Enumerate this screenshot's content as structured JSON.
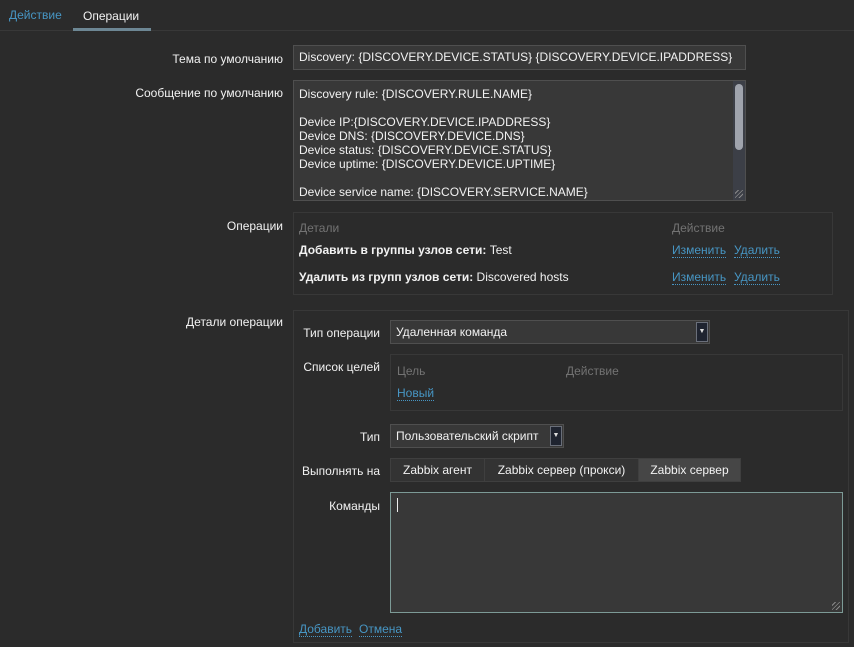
{
  "tabs": [
    {
      "label": "Действие",
      "active": false
    },
    {
      "label": "Операции",
      "active": true
    }
  ],
  "form": {
    "subject_label": "Тема по умолчанию",
    "subject_value": "Discovery: {DISCOVERY.DEVICE.STATUS} {DISCOVERY.DEVICE.IPADDRESS}",
    "message_label": "Сообщение по умолчанию",
    "message_lines": [
      "Discovery rule: {DISCOVERY.RULE.NAME}",
      "",
      "Device IP:{DISCOVERY.DEVICE.IPADDRESS}",
      "Device DNS: {DISCOVERY.DEVICE.DNS}",
      "Device status: {DISCOVERY.DEVICE.STATUS}",
      "Device uptime: {DISCOVERY.DEVICE.UPTIME}",
      "",
      "Device service name: {DISCOVERY.SERVICE.NAME}"
    ],
    "operations_label": "Операции",
    "operations": {
      "headers": [
        "Детали",
        "Действие"
      ],
      "rows": [
        {
          "bold": "Добавить в группы узлов сети:",
          "value": " Test",
          "edit": "Изменить",
          "delete": "Удалить"
        },
        {
          "bold": "Удалить из групп узлов сети:",
          "value": " Discovered hosts",
          "edit": "Изменить",
          "delete": "Удалить"
        }
      ]
    },
    "details_label": "Детали операции",
    "details": {
      "op_type_label": "Тип операции",
      "op_type_value": "Удаленная команда",
      "targets_label": "Список целей",
      "targets_headers": [
        "Цель",
        "Действие"
      ],
      "targets_new": "Новый",
      "type_label": "Тип",
      "type_value": "Пользовательский скрипт",
      "execute_label": "Выполнять на",
      "execute_options": [
        "Zabbix агент",
        "Zabbix сервер (прокси)",
        "Zabbix сервер"
      ],
      "execute_selected": "Zabbix сервер",
      "commands_label": "Команды",
      "commands_value": "",
      "add": "Добавить",
      "cancel": "Отмена"
    }
  },
  "colors": {
    "background": "#2b2b2b",
    "link": "#4796c4",
    "input": "#383838"
  }
}
